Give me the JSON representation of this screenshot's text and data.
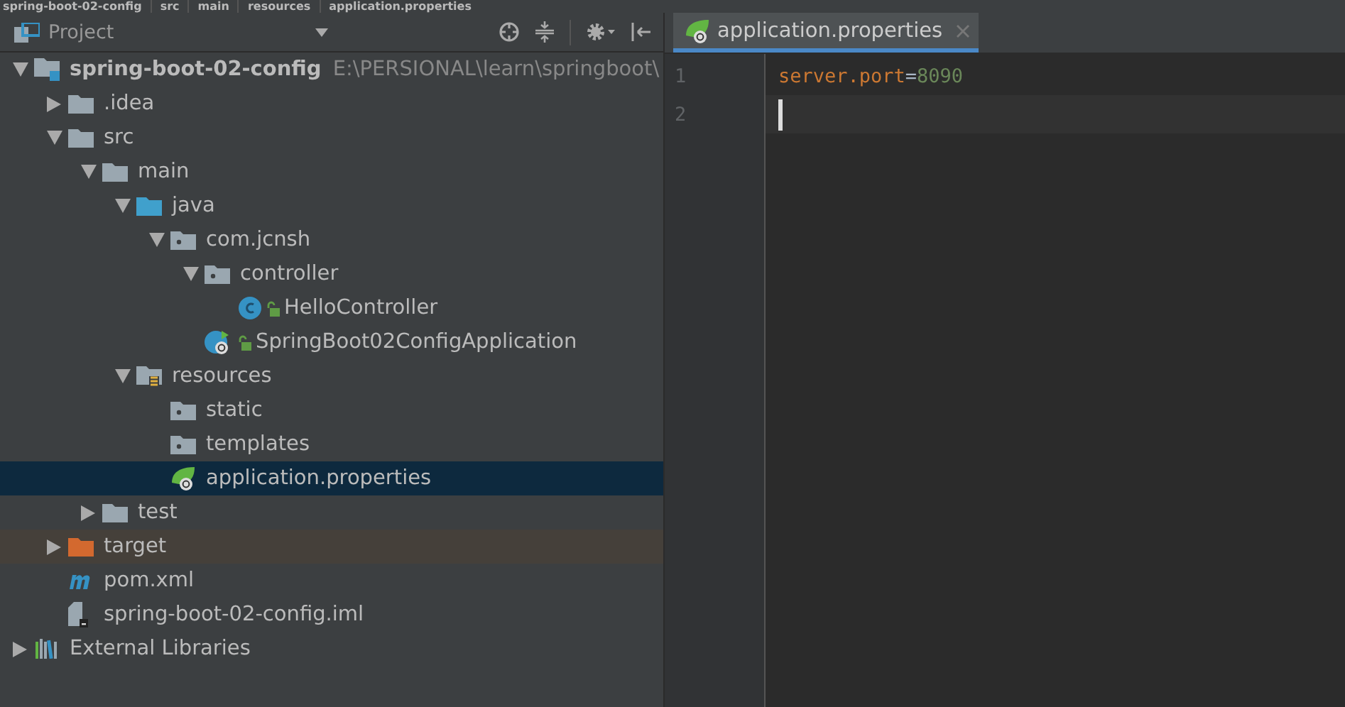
{
  "breadcrumbs": [
    "spring-boot-02-config",
    "src",
    "main",
    "resources",
    "application.properties"
  ],
  "project_panel": {
    "title": "Project",
    "tree": [
      {
        "label": "spring-boot-02-config",
        "path": "E:\\PERSIONAL\\learn\\springboot\\",
        "kind": "module",
        "expanded": true,
        "selected": false,
        "children": [
          {
            "label": ".idea",
            "kind": "folder",
            "expanded": false,
            "selected": false
          },
          {
            "label": "src",
            "kind": "folder",
            "expanded": true,
            "selected": false,
            "children": [
              {
                "label": "main",
                "kind": "folder",
                "expanded": true,
                "selected": false,
                "children": [
                  {
                    "label": "java",
                    "kind": "source-folder",
                    "expanded": true,
                    "selected": false,
                    "children": [
                      {
                        "label": "com.jcnsh",
                        "kind": "package",
                        "expanded": true,
                        "selected": false,
                        "children": [
                          {
                            "label": "controller",
                            "kind": "package",
                            "expanded": true,
                            "selected": false,
                            "children": [
                              {
                                "label": "HelloController",
                                "kind": "class",
                                "selected": false
                              }
                            ]
                          },
                          {
                            "label": "SpringBoot02ConfigApplication",
                            "kind": "spring-class",
                            "selected": false
                          }
                        ]
                      }
                    ]
                  },
                  {
                    "label": "resources",
                    "kind": "resources-folder",
                    "expanded": true,
                    "selected": false,
                    "children": [
                      {
                        "label": "static",
                        "kind": "package",
                        "selected": false
                      },
                      {
                        "label": "templates",
                        "kind": "package",
                        "selected": false
                      },
                      {
                        "label": "application.properties",
                        "kind": "properties",
                        "selected": true
                      }
                    ]
                  }
                ]
              },
              {
                "label": "test",
                "kind": "folder",
                "expanded": false,
                "selected": false
              }
            ]
          },
          {
            "label": "target",
            "kind": "excluded-folder",
            "expanded": false,
            "selected": false
          },
          {
            "label": "pom.xml",
            "kind": "maven",
            "selected": false
          },
          {
            "label": "spring-boot-02-config.iml",
            "kind": "iml",
            "selected": false
          }
        ]
      },
      {
        "label": "External Libraries",
        "kind": "libraries",
        "expanded": false,
        "selected": false
      }
    ]
  },
  "editor": {
    "tabs": [
      {
        "label": "application.properties",
        "selected": true
      }
    ],
    "lines": [
      {
        "number": "1",
        "key": "server.port",
        "separator": "=",
        "value": "8090",
        "current": false
      },
      {
        "number": "2",
        "current": true
      }
    ]
  }
}
